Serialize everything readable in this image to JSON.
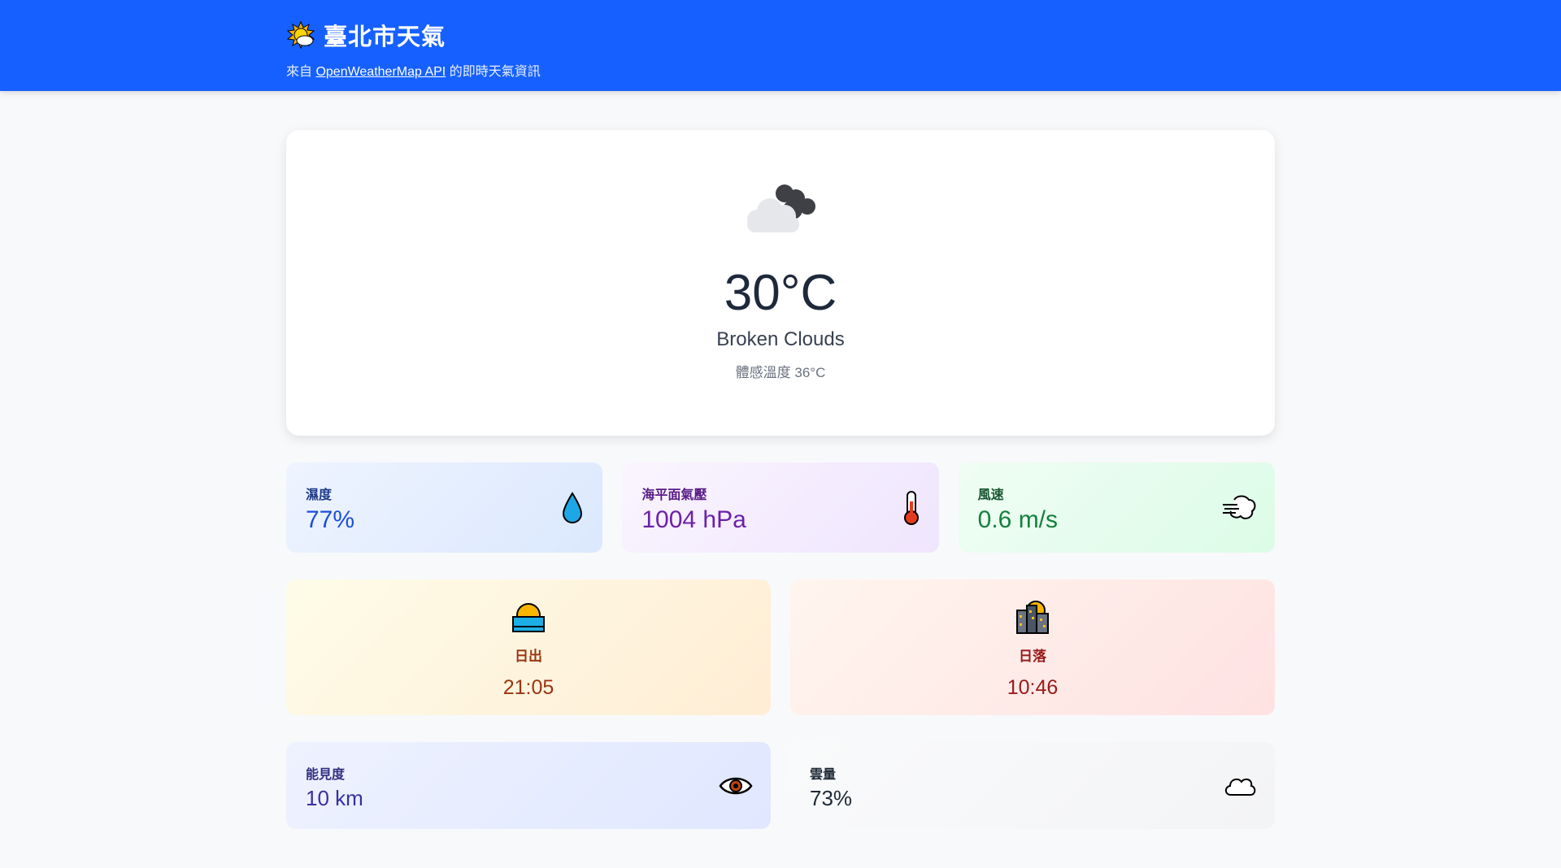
{
  "header": {
    "title": "臺北市天氣",
    "subtitle_prefix": "來自 ",
    "subtitle_link": "OpenWeatherMap API",
    "subtitle_suffix": " 的即時天氣資訊",
    "title_icon": "sun-behind-cloud-icon"
  },
  "current": {
    "icon": "broken-clouds-icon",
    "temperature": "30°C",
    "description": "Broken Clouds",
    "feels_like": "體感溫度 36°C"
  },
  "stats": {
    "humidity": {
      "label": "濕度",
      "value": "77%",
      "icon": "droplet-icon"
    },
    "pressure": {
      "label": "海平面氣壓",
      "value": "1004 hPa",
      "icon": "thermometer-icon"
    },
    "wind": {
      "label": "風速",
      "value": "0.6 m/s",
      "icon": "wind-icon"
    }
  },
  "sun": {
    "sunrise": {
      "label": "日出",
      "value": "21:05",
      "icon": "sunrise-icon"
    },
    "sunset": {
      "label": "日落",
      "value": "10:46",
      "icon": "city-sunset-icon"
    }
  },
  "extra": {
    "visibility": {
      "label": "能見度",
      "value": "10 km",
      "icon": "eye-icon"
    },
    "clouds": {
      "label": "雲量",
      "value": "73%",
      "icon": "cloud-icon"
    }
  },
  "colors": {
    "header_bg": "#1660ff",
    "page_bg": "#f8f9fb"
  }
}
